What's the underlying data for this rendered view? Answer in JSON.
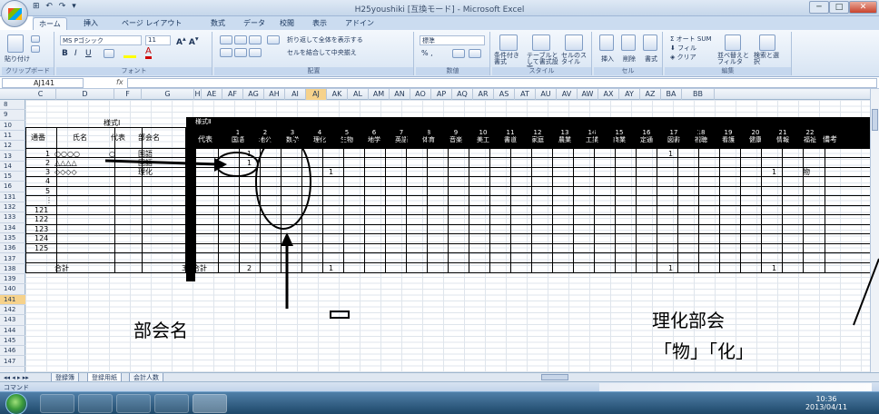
{
  "window": {
    "title": "H25youshiki [互換モード] - Microsoft Excel",
    "quick_access": "⊞ ↶ ↷ ▾",
    "min": "─",
    "max": "□",
    "close": "✕"
  },
  "ribbon_tabs": [
    "ホーム",
    "挿入",
    "ページ レイアウト",
    "数式",
    "データ",
    "校閲",
    "表示",
    "アドイン"
  ],
  "ribbon": {
    "paste": "貼り付け",
    "font_name": "MS Pゴシック",
    "font_size": "11",
    "wrap_text": "折り返して全体を表示する",
    "merge_center": "セルを結合して中央揃え",
    "number_format": "標準",
    "cond_format": "条件付き書式",
    "table_format": "テーブルとして書式設定",
    "cell_style": "セルのスタイル",
    "insert": "挿入",
    "delete": "削除",
    "format": "書式",
    "autosum": "オート SUM",
    "fill": "フィル",
    "clear": "クリア",
    "sort": "並べ替えとフィルタ",
    "find": "検索と選択",
    "groups": [
      "クリップボード",
      "フォント",
      "配置",
      "数値",
      "スタイル",
      "セル",
      "編集"
    ]
  },
  "formula_bar": {
    "name_box": "AJ141",
    "fx": "fx",
    "formula": ""
  },
  "columns": [
    "C",
    "D",
    "F",
    "G",
    "H",
    "AE",
    "AF",
    "AG",
    "AH",
    "AI",
    "AJ",
    "AK",
    "AL",
    "AM",
    "AN",
    "AO",
    "AP",
    "AQ",
    "AR",
    "AS",
    "AT",
    "AU",
    "AV",
    "AW",
    "AX",
    "AY",
    "AZ",
    "BA",
    "BB"
  ],
  "selected_column": "AJ",
  "rows": [
    "8",
    "9",
    "10",
    "11",
    "12",
    "13",
    "14",
    "15",
    "16",
    "131",
    "132",
    "133",
    "134",
    "135",
    "136",
    "137",
    "138",
    "139",
    "140",
    "141",
    "142",
    "143",
    "144",
    "145",
    "146",
    "147"
  ],
  "selected_row": "141",
  "sheet": {
    "form1_label": "様式Ⅰ",
    "form2_label": "様式Ⅱ",
    "hdr_no": "通番",
    "hdr_name": "氏名",
    "hdr_rep": "代表",
    "hdr_dept": "部会名",
    "hdr_rep2": "代表",
    "hdr_note": "備考",
    "subjects": [
      {
        "n": "1",
        "s": "国語"
      },
      {
        "n": "2",
        "s": "地公"
      },
      {
        "n": "3",
        "s": "数学"
      },
      {
        "n": "4",
        "s": "理化"
      },
      {
        "n": "5",
        "s": "生物"
      },
      {
        "n": "6",
        "s": "地学"
      },
      {
        "n": "7",
        "s": "英語"
      },
      {
        "n": "8",
        "s": "体育"
      },
      {
        "n": "9",
        "s": "音楽"
      },
      {
        "n": "10",
        "s": "美工"
      },
      {
        "n": "11",
        "s": "書道"
      },
      {
        "n": "12",
        "s": "家庭"
      },
      {
        "n": "13",
        "s": "農業"
      },
      {
        "n": "14",
        "s": "工業"
      },
      {
        "n": "15",
        "s": "商業"
      },
      {
        "n": "16",
        "s": "定通"
      },
      {
        "n": "17",
        "s": "図書"
      },
      {
        "n": "18",
        "s": "視聴"
      },
      {
        "n": "19",
        "s": "看護"
      },
      {
        "n": "20",
        "s": "健康"
      },
      {
        "n": "21",
        "s": "情報"
      },
      {
        "n": "22",
        "s": "福祉"
      }
    ],
    "r12": {
      "no": "1",
      "name": "○○○○",
      "rep": "○",
      "dept": "国語"
    },
    "r13": {
      "no": "2",
      "name": "△△△△",
      "dept": "国語"
    },
    "r14": {
      "no": "3",
      "name": "◇◇◇◇",
      "dept": "理化"
    },
    "r15_no": "4",
    "r16_no": "5",
    "r131": "⋮",
    "rows_tail": [
      "121",
      "122",
      "123",
      "124",
      "125"
    ],
    "total_label": "合計",
    "total_rep": "3",
    "total_label2": "合計",
    "one": "1",
    "total_af": "2",
    "note_phys": "物"
  },
  "sheet_tabs": [
    "登録簿",
    "登録用紙",
    "会計人数"
  ],
  "status": "コマンド",
  "tray": {
    "time": "10:36",
    "date": "2013/04/11"
  },
  "annotations": {
    "dept_name": "部会名",
    "physchem": "理化部会",
    "phys_chem_quote": "「物」「化」"
  }
}
